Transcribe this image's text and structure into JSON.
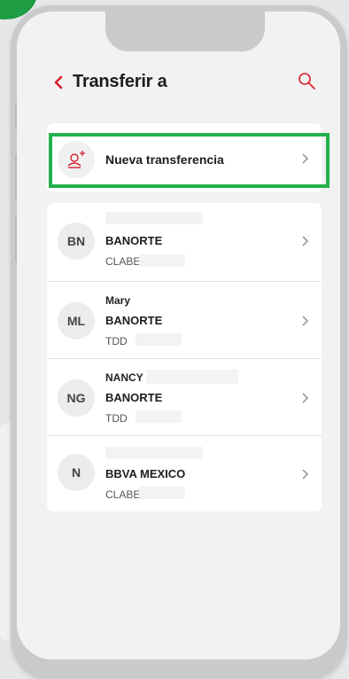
{
  "header": {
    "title": "Transferir a"
  },
  "new_transfer": {
    "label": "Nueva transferencia"
  },
  "accounts": [
    {
      "initials": "BN",
      "name": "",
      "bank": "BANORTE",
      "type": "CLABE"
    },
    {
      "initials": "ML",
      "name": "Mary",
      "bank": "BANORTE",
      "type": "TDD"
    },
    {
      "initials": "NG",
      "name": "NANCY",
      "bank": "BANORTE",
      "type": "TDD"
    },
    {
      "initials": "N",
      "name": "",
      "bank": "BBVA MEXICO",
      "type": "CLABE"
    }
  ],
  "colors": {
    "accent": "#d3202a",
    "highlight": "#22b14c"
  },
  "icons": {
    "back": "chevron-left-icon",
    "search": "search-icon",
    "new_transfer": "add-person-icon",
    "row_arrow": "chevron-right-icon"
  }
}
